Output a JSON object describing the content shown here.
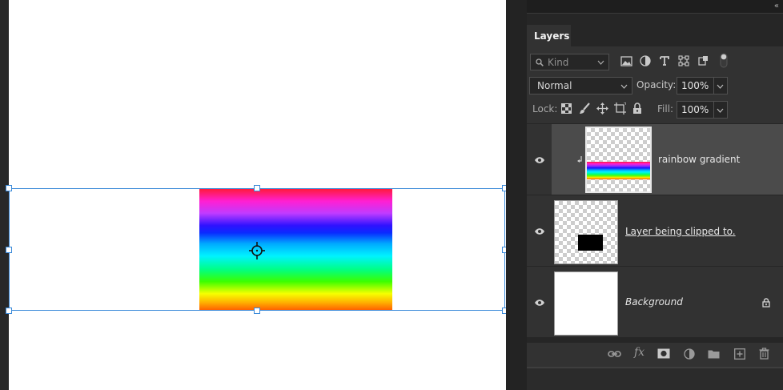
{
  "app": {
    "colors": {
      "canvas_bg": "#ffffff",
      "panel_bg": "#323232",
      "selected_layer": "#4b4b4b",
      "transform_box": "#3b8ad9"
    }
  },
  "panel": {
    "collapse_icon": "«",
    "tab": "Layers",
    "filter": {
      "placeholder": "Kind",
      "icons": [
        "image-filter-icon",
        "adjustment-filter-icon",
        "type-filter-icon",
        "shape-filter-icon",
        "smart-object-filter-icon",
        "filter-toggle-icon"
      ]
    },
    "blend_mode": "Normal",
    "opacity_label": "Opacity:",
    "opacity_value": "100%",
    "lock_label": "Lock:",
    "lock_icons": [
      "lock-transparent-icon",
      "lock-image-icon",
      "lock-position-icon",
      "lock-artboard-icon",
      "lock-all-icon"
    ],
    "fill_label": "Fill:",
    "fill_value": "100%",
    "layers": [
      {
        "name": "rainbow gradient",
        "selected": true,
        "clipped": true
      },
      {
        "name": "Layer being clipped to.",
        "selected": false,
        "clipped": false
      },
      {
        "name": "Background",
        "selected": false,
        "locked": true
      }
    ],
    "footer_icons": [
      "link-layers-icon",
      "fx-icon",
      "add-mask-icon",
      "adjustment-layer-icon",
      "new-group-icon",
      "new-layer-icon",
      "delete-layer-icon"
    ],
    "fx_label": "fx"
  }
}
